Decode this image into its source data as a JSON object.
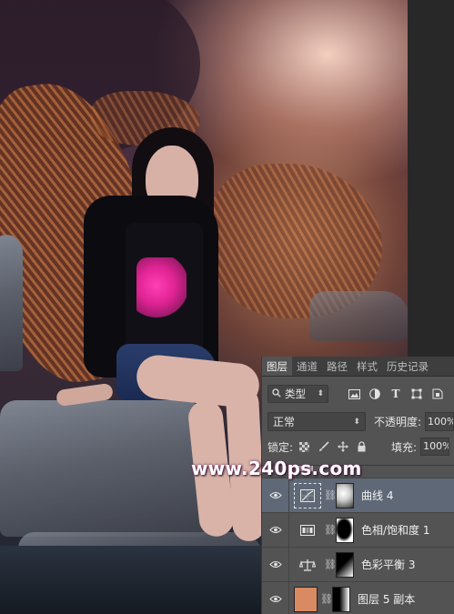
{
  "watermark": "www.240ps.com",
  "layers_panel": {
    "tabs": [
      "图层",
      "通道",
      "路径",
      "样式",
      "历史记录"
    ],
    "active_tab": "图层",
    "filter": {
      "kind_label": "类型",
      "icons": [
        "image-filter-icon",
        "adjustment-filter-icon",
        "type-filter-icon",
        "shape-filter-icon",
        "smart-object-filter-icon"
      ]
    },
    "blend_mode": "正常",
    "opacity_label": "不透明度:",
    "opacity_value": "100%",
    "lock_label": "锁定:",
    "lock_icons": [
      "lock-transparent-icon",
      "lock-paint-icon",
      "lock-position-icon",
      "lock-all-icon"
    ],
    "fill_label": "填充:",
    "fill_value": "100%",
    "layers": [
      {
        "name": "曲线 4",
        "type": "curves-adjustment-icon",
        "selected": true
      },
      {
        "name": "色相/饱和度 1",
        "type": "hue-saturation-adjustment-icon",
        "selected": false
      },
      {
        "name": "色彩平衡 3",
        "type": "color-balance-adjustment-icon",
        "selected": false
      },
      {
        "name": "图层 5 副本",
        "type": "layer-thumbnail",
        "selected": false
      }
    ]
  },
  "colors": {
    "panel_bg": "#535353",
    "tab_bar_bg": "#3e3e3e",
    "selected_layer_bg": "#5f6877",
    "layer_thumb_orange": "#d98a62"
  }
}
